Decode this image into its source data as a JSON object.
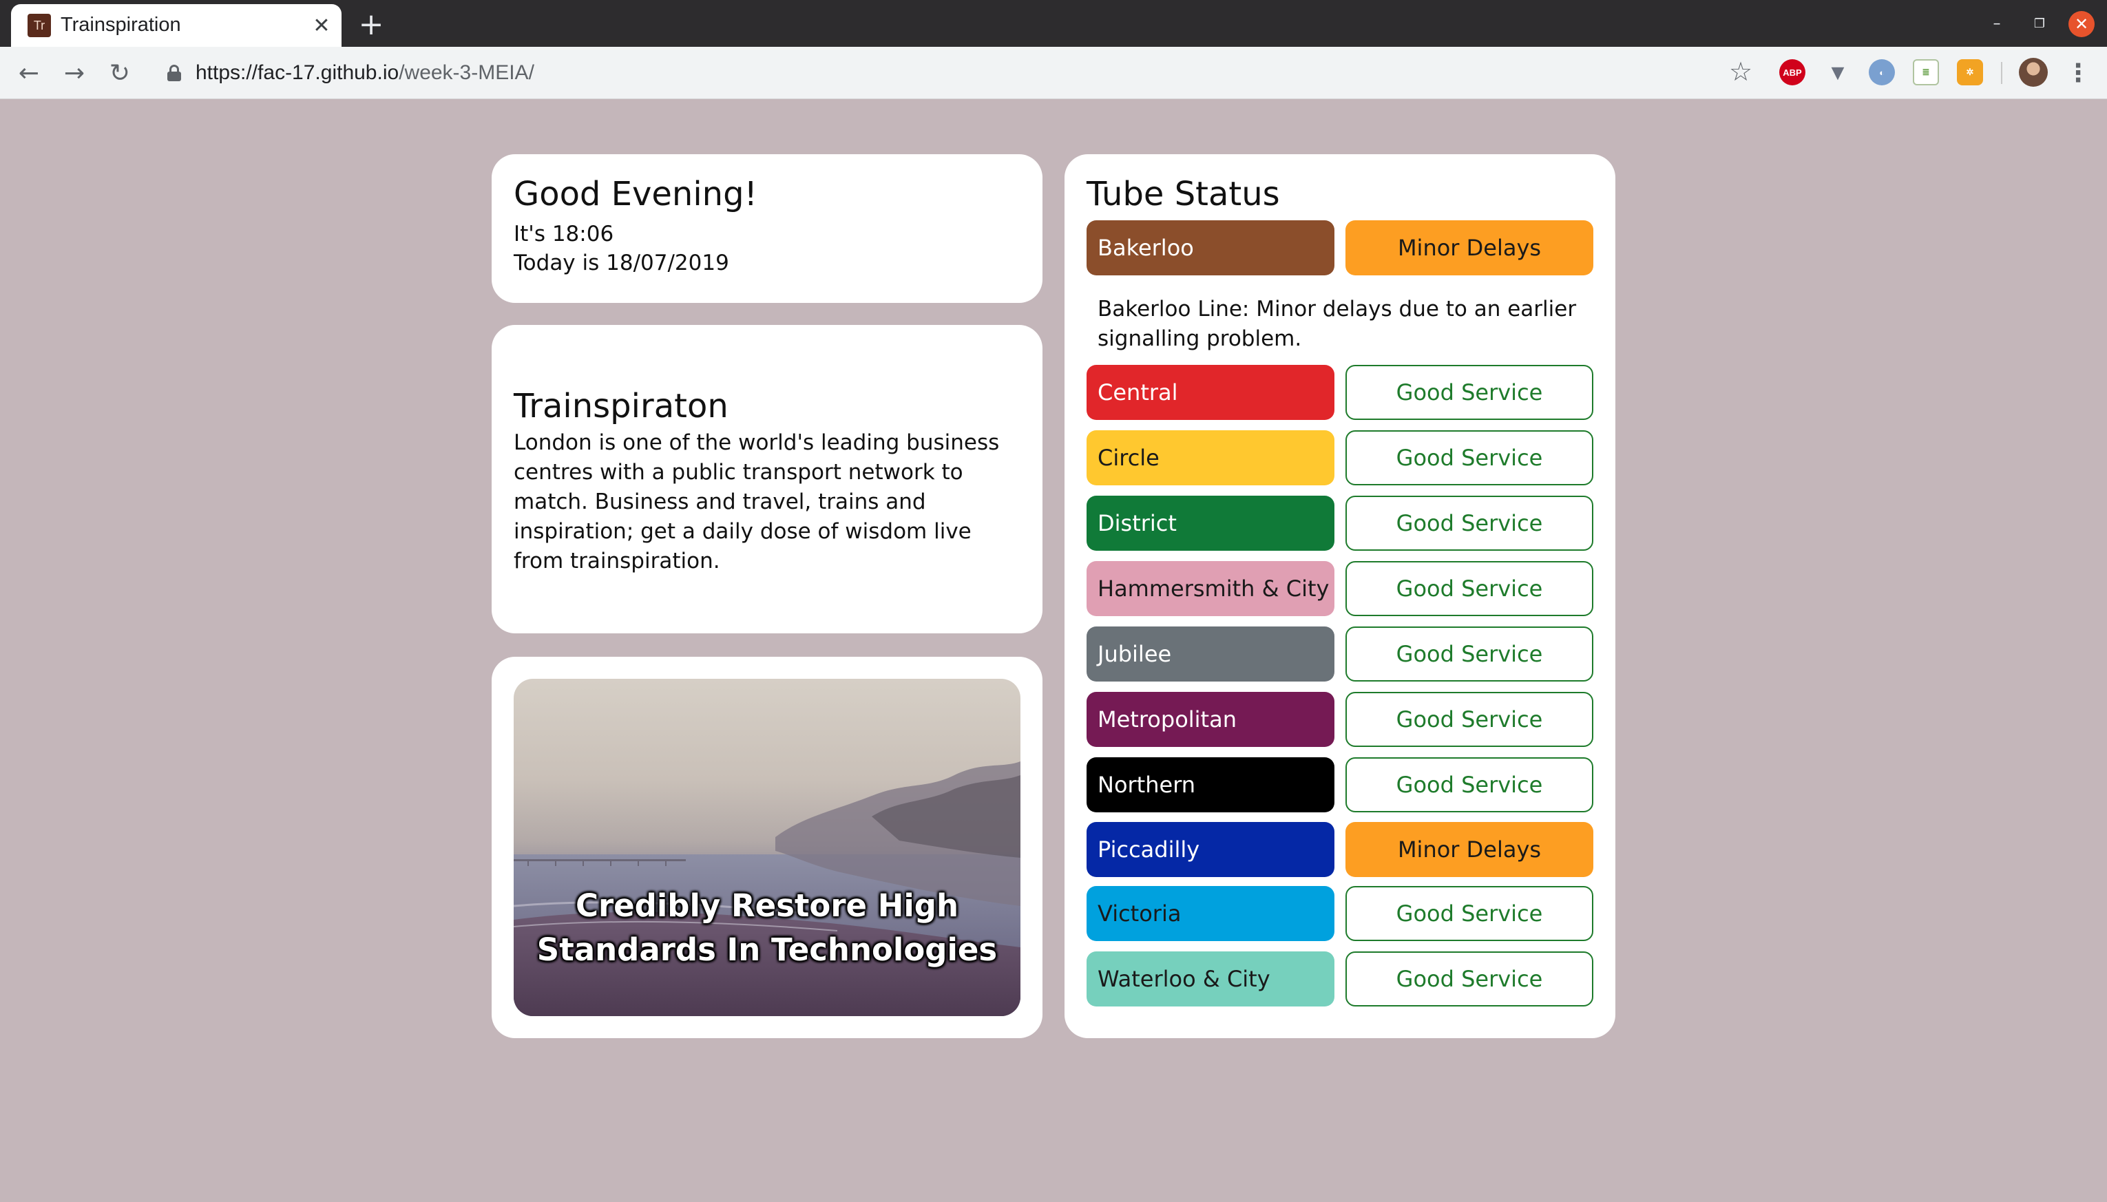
{
  "browser": {
    "tab_title": "Trainspiration",
    "favicon_text": "Tr",
    "url_host": "https://fac-17.github.io",
    "url_path": "/week-3-MEIA/",
    "extensions": [
      "ABP"
    ]
  },
  "greeting": {
    "title": "Good Evening!",
    "time_line": "It's 18:06",
    "date_line": "Today is 18/07/2019"
  },
  "about": {
    "title": "Trainspiraton",
    "text": "London is one of the world's leading business centres with a public transport network to match. Business and travel, trains and inspiration; get a daily dose of wisdom live from trainspiration."
  },
  "quote": {
    "text": "Credibly Restore High Standards In Technologies"
  },
  "tube": {
    "title": "Tube Status",
    "disruption_text": "Bakerloo Line: Minor delays due to an earlier signalling problem.",
    "lines": [
      {
        "name": "Bakerloo",
        "status": "Minor Delays",
        "color": "#8b4e2b",
        "text_color": "#ffffff"
      },
      {
        "name": "Central",
        "status": "Good Service",
        "color": "#e1262a",
        "text_color": "#ffffff"
      },
      {
        "name": "Circle",
        "status": "Good Service",
        "color": "#ffc82f",
        "text_color": "#1a1a1a"
      },
      {
        "name": "District",
        "status": "Good Service",
        "color": "#107a38",
        "text_color": "#ffffff"
      },
      {
        "name": "Hammersmith & City",
        "status": "Good Service",
        "color": "#e09fb3",
        "text_color": "#1a1a1a"
      },
      {
        "name": "Jubilee",
        "status": "Good Service",
        "color": "#6a7278",
        "text_color": "#ffffff"
      },
      {
        "name": "Metropolitan",
        "status": "Good Service",
        "color": "#751a54",
        "text_color": "#ffffff"
      },
      {
        "name": "Northern",
        "status": "Good Service",
        "color": "#000000",
        "text_color": "#ffffff"
      },
      {
        "name": "Piccadilly",
        "status": "Minor Delays",
        "color": "#0528a6",
        "text_color": "#ffffff"
      },
      {
        "name": "Victoria",
        "status": "Good Service",
        "color": "#00a1de",
        "text_color": "#1a1a1a"
      },
      {
        "name": "Waterloo & City",
        "status": "Good Service",
        "color": "#76d0bd",
        "text_color": "#1a1a1a"
      }
    ]
  },
  "colors": {
    "page_background": "#c4b6ba",
    "good_service": "#1e7b2b",
    "minor_delays": "#fd9e22"
  }
}
